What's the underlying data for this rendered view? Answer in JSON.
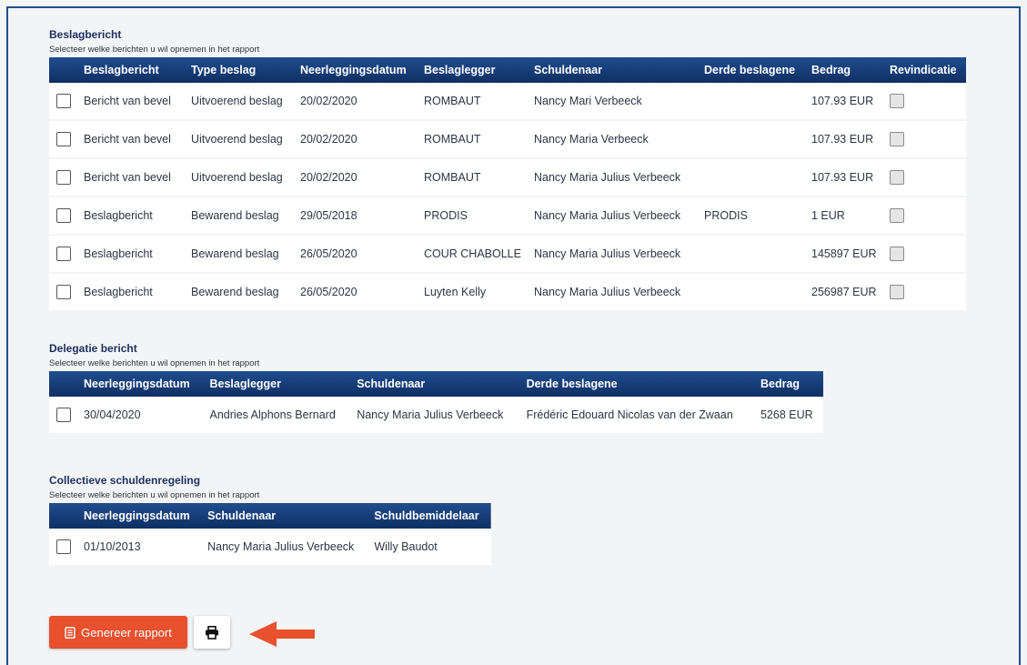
{
  "section1": {
    "title": "Beslagbericht",
    "subtitle": "Selecteer welke berichten u wil opnemen in het rapport",
    "headers": [
      "Beslagbericht",
      "Type beslag",
      "Neerleggingsdatum",
      "Beslaglegger",
      "Schuldenaar",
      "Derde beslagene",
      "Bedrag",
      "Revindicatie"
    ],
    "rows": [
      [
        "Bericht van bevel",
        "Uitvoerend beslag",
        "20/02/2020",
        "ROMBAUT",
        "Nancy Mari Verbeeck",
        "",
        "107.93 EUR"
      ],
      [
        "Bericht van bevel",
        "Uitvoerend beslag",
        "20/02/2020",
        "ROMBAUT",
        "Nancy Maria Verbeeck",
        "",
        "107.93 EUR"
      ],
      [
        "Bericht van bevel",
        "Uitvoerend beslag",
        "20/02/2020",
        "ROMBAUT",
        "Nancy Maria Julius Verbeeck",
        "",
        "107.93 EUR"
      ],
      [
        "Beslagbericht",
        "Bewarend beslag",
        "29/05/2018",
        "PRODIS",
        "Nancy Maria Julius Verbeeck",
        "PRODIS",
        "1 EUR"
      ],
      [
        "Beslagbericht",
        "Bewarend beslag",
        "26/05/2020",
        "COUR CHABOLLE",
        "Nancy Maria Julius Verbeeck",
        "",
        "145897 EUR"
      ],
      [
        "Beslagbericht",
        "Bewarend beslag",
        "26/05/2020",
        "Luyten Kelly",
        "Nancy Maria Julius Verbeeck",
        "",
        "256987 EUR"
      ]
    ]
  },
  "section2": {
    "title": "Delegatie bericht",
    "subtitle": "Selecteer welke berichten u wil opnemen in het rapport",
    "headers": [
      "Neerleggingsdatum",
      "Beslaglegger",
      "Schuldenaar",
      "Derde beslagene",
      "Bedrag"
    ],
    "rows": [
      [
        "30/04/2020",
        "Andries Alphons Bernard",
        "Nancy Maria Julius Verbeeck",
        "Frédéric Edouard Nicolas van der Zwaan",
        "5268 EUR"
      ]
    ]
  },
  "section3": {
    "title": "Collectieve schuldenregeling",
    "subtitle": "Selecteer welke berichten u wil opnemen in het rapport",
    "headers": [
      "Neerleggingsdatum",
      "Schuldenaar",
      "Schuldbemiddelaar"
    ],
    "rows": [
      [
        "01/10/2013",
        "Nancy Maria Julius Verbeeck",
        "Willy Baudot"
      ]
    ]
  },
  "actions": {
    "generate_label": "Genereer rapport",
    "generate_icon": "document-icon",
    "print_icon": "printer-icon",
    "arrow_icon": "arrow-left-icon"
  },
  "colors": {
    "header_bg": "#163d78",
    "accent_orange": "#e8502e",
    "frame_border": "#1d4f8c"
  }
}
